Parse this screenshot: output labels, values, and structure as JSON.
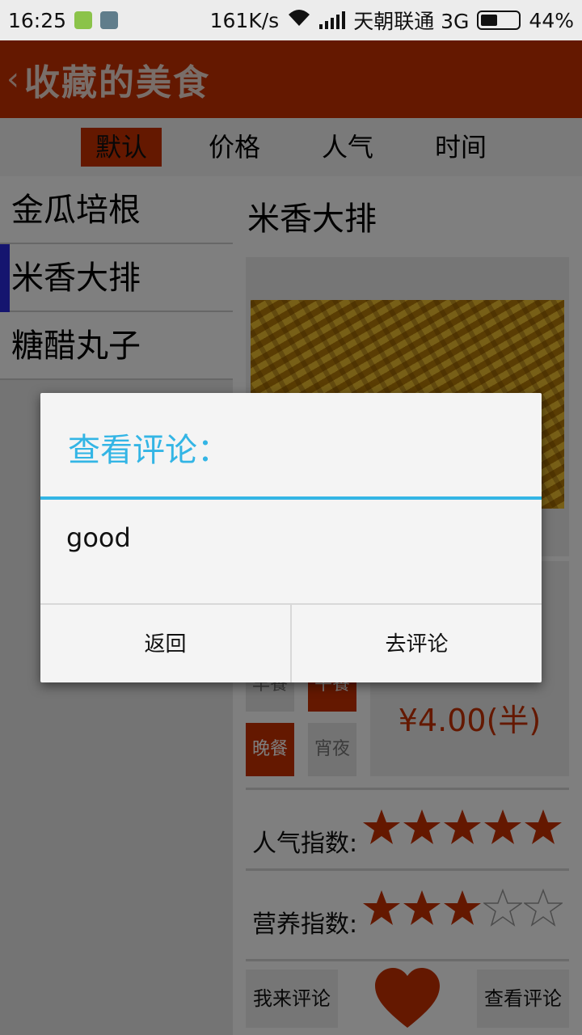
{
  "status_bar": {
    "time": "16:25",
    "net_speed": "161K/s",
    "carrier": "天朝联通 3G",
    "battery": "44%"
  },
  "header": {
    "title": "收藏的美食",
    "back_icon": "chevron-left-icon"
  },
  "sort_tabs": [
    {
      "label": "默认",
      "active": true
    },
    {
      "label": "价格",
      "active": false
    },
    {
      "label": "人气",
      "active": false
    },
    {
      "label": "时间",
      "active": false
    }
  ],
  "food_list": [
    {
      "name": "金瓜培根",
      "selected": false
    },
    {
      "name": "米香大排",
      "selected": true
    },
    {
      "name": "糖醋丸子",
      "selected": false
    }
  ],
  "detail": {
    "name": "米香大排",
    "meals": {
      "breakfast": "早餐",
      "lunch": "午餐",
      "dinner": "晚餐",
      "night": "宵夜"
    },
    "price": "¥4.00(半)",
    "popularity_label": "人气指数:",
    "popularity_stars": 5,
    "nutrition_label": "营养指数:",
    "nutrition_stars": 3,
    "max_stars": 5,
    "comment_button": "我来评论",
    "view_comments_button": "查看评论",
    "favorite_icon": "heart-icon"
  },
  "dialog": {
    "title": "查看评论：",
    "comment": "good",
    "back_button": "返回",
    "go_comment_button": "去评论"
  },
  "colors": {
    "accent": "#c83000",
    "dialog_title": "#33b5e5"
  }
}
